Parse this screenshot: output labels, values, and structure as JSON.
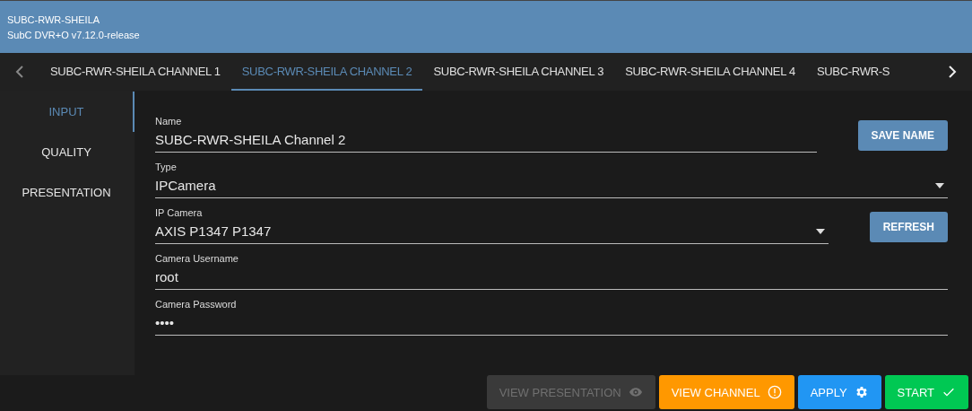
{
  "header": {
    "title": "SUBC-RWR-SHEILA",
    "subtitle": "SubC DVR+O v7.12.0-release"
  },
  "tabs": [
    {
      "label": "SUBC-RWR-SHEILA CHANNEL 1",
      "selected": false
    },
    {
      "label": "SUBC-RWR-SHEILA CHANNEL 2",
      "selected": true
    },
    {
      "label": "SUBC-RWR-SHEILA CHANNEL 3",
      "selected": false
    },
    {
      "label": "SUBC-RWR-SHEILA CHANNEL 4",
      "selected": false
    },
    {
      "label": "SUBC-RWR-S",
      "selected": false
    }
  ],
  "sidebar": {
    "items": [
      {
        "label": "INPUT",
        "selected": true
      },
      {
        "label": "QUALITY",
        "selected": false
      },
      {
        "label": "PRESENTATION",
        "selected": false
      }
    ]
  },
  "form": {
    "fields": [
      {
        "kind": "text",
        "label": "Name",
        "value": "SUBC-RWR-SHEILA Channel 2",
        "button": "SAVE NAME"
      },
      {
        "kind": "select",
        "label": "Type",
        "value": "IPCamera"
      },
      {
        "kind": "select",
        "label": "IP Camera",
        "value": "AXIS P1347 P1347",
        "button": "REFRESH"
      },
      {
        "kind": "text",
        "label": "Camera Username",
        "value": "root"
      },
      {
        "kind": "text",
        "label": "Camera Password",
        "value": "••••"
      }
    ]
  },
  "actions": [
    {
      "label": "VIEW PRESENTATION",
      "kind": "eye",
      "color": "#3a3a3a",
      "disabled": true
    },
    {
      "label": "VIEW CHANNEL",
      "kind": "alert",
      "color": "#ff9800",
      "disabled": false
    },
    {
      "label": "APPLY",
      "kind": "gear",
      "color": "#2196f3",
      "disabled": false
    },
    {
      "label": "START",
      "kind": "check",
      "color": "#00c853",
      "disabled": false
    }
  ]
}
